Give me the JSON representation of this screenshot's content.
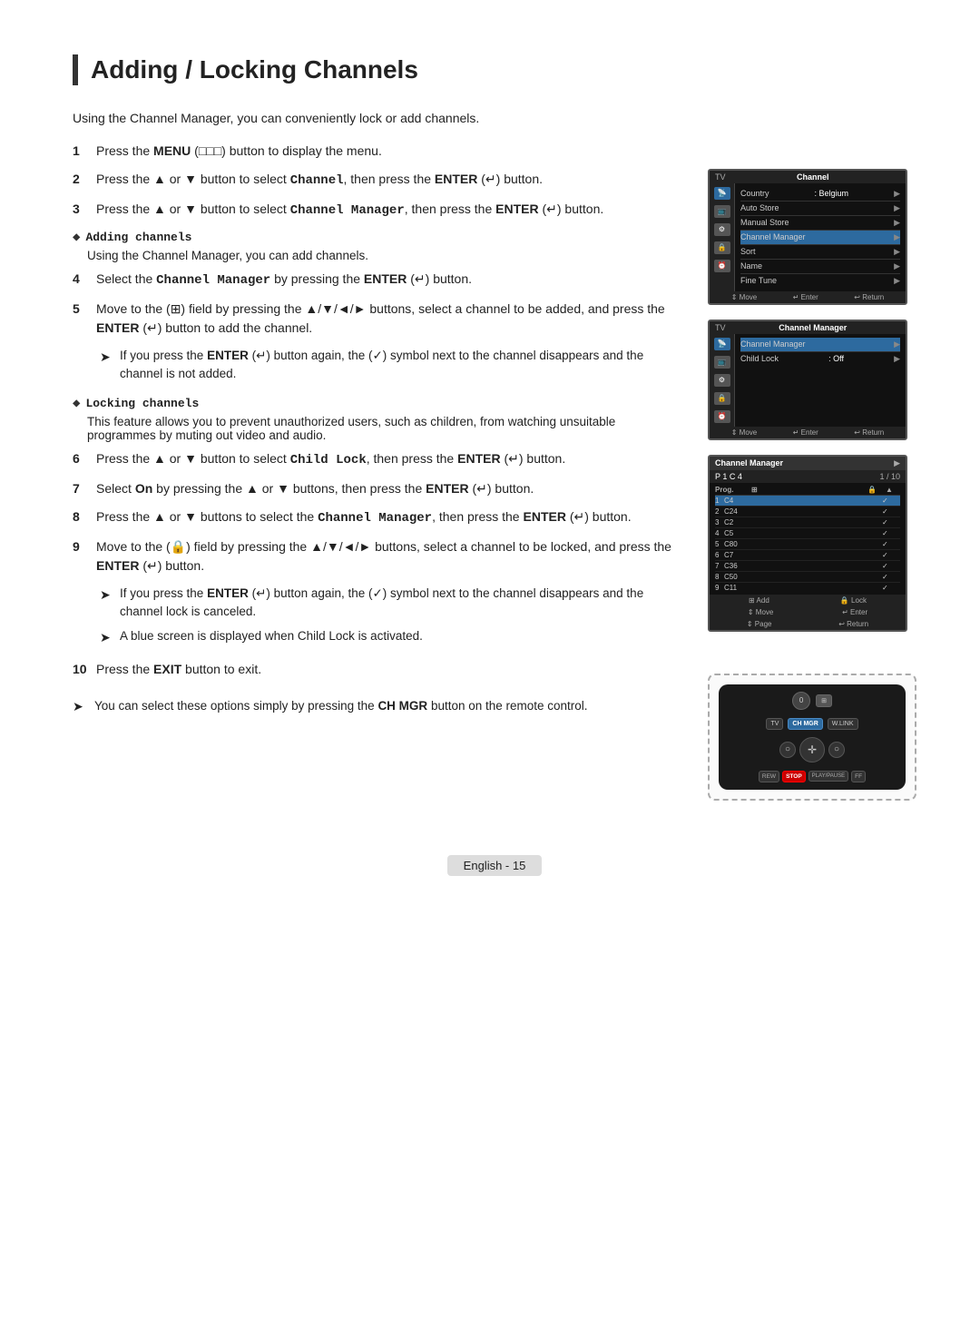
{
  "page": {
    "title": "Adding / Locking Channels",
    "intro": "Using the Channel Manager, you can conveniently lock or add channels.",
    "footer": "English - 15"
  },
  "steps": [
    {
      "num": "1",
      "text": "Press the MENU (□□□) button to display the menu."
    },
    {
      "num": "2",
      "text": "Press the ▲ or ▼ button to select Channel, then press the ENTER (↵) button."
    },
    {
      "num": "3",
      "text": "Press the ▲ or ▼ button to select Channel Manager, then press the ENTER (↵) button."
    }
  ],
  "adding_section": {
    "header": "Adding channels",
    "desc": "Using the Channel Manager, you can add channels.",
    "steps": [
      {
        "num": "4",
        "text": "Select the Channel Manager by pressing the ENTER (↵) button."
      },
      {
        "num": "5",
        "text": "Move to the (⊞) field by pressing the ▲/▼/◄/► buttons, select a channel to be added, and press the ENTER (↵) button to add the channel."
      }
    ],
    "arrow_notes": [
      "If you press the ENTER (↵) button again, the (✓) symbol next to the channel disappears and the channel is not added."
    ]
  },
  "locking_section": {
    "header": "Locking channels",
    "desc": "This feature allows you to prevent unauthorized users, such as children, from watching unsuitable programmes by muting out video and audio.",
    "steps": [
      {
        "num": "6",
        "text": "Press the ▲ or ▼ button to select Child Lock, then press the ENTER (↵) button."
      },
      {
        "num": "7",
        "text": "Select On by pressing the ▲ or ▼ buttons, then press the ENTER (↵) button."
      },
      {
        "num": "8",
        "text": "Press the ▲ or ▼ buttons to select the Channel Manager, then press the ENTER (↵) button."
      },
      {
        "num": "9",
        "text": "Move to the (🔒) field by pressing the ▲/▼/◄/► buttons, select a channel to be locked, and press the ENTER (↵) button."
      }
    ],
    "arrow_notes": [
      "If you press the ENTER (↵) button again, the (✓) symbol next to the channel disappears and the channel lock is canceled.",
      "A blue screen is displayed when Child Lock is activated."
    ]
  },
  "step10": {
    "num": "10",
    "text": "Press the EXIT button to exit."
  },
  "footer_note": "You can select these options simply by pressing the CH MGR button on the remote control.",
  "tv_screen1": {
    "title": "Channel",
    "items": [
      {
        "label": "Country",
        "value": ": Belgium"
      },
      {
        "label": "Auto Store",
        "value": ""
      },
      {
        "label": "Manual Store",
        "value": ""
      },
      {
        "label": "Channel Manager",
        "value": ""
      },
      {
        "label": "Sort",
        "value": ""
      },
      {
        "label": "Name",
        "value": ""
      },
      {
        "label": "Fine Tune",
        "value": ""
      }
    ],
    "footer": [
      "⇕ Move",
      "↵ Enter",
      "↩ Return"
    ]
  },
  "tv_screen2": {
    "title": "Channel Manager",
    "items": [
      {
        "label": "Channel Manager",
        "value": ""
      },
      {
        "label": "Child Lock",
        "value": ": Off"
      }
    ],
    "footer": [
      "⇕ Move",
      "↵ Enter",
      "↩ Return"
    ]
  },
  "tv_screen3": {
    "title": "Channel Manager",
    "subtitle": "P 1  C 4",
    "page": "1 / 10",
    "channels": [
      {
        "prog": "1",
        "ch": "C4",
        "check": "✓"
      },
      {
        "prog": "2",
        "ch": "C24",
        "check": "✓"
      },
      {
        "prog": "3",
        "ch": "C2",
        "check": "✓"
      },
      {
        "prog": "4",
        "ch": "C5",
        "check": "✓"
      },
      {
        "prog": "5",
        "ch": "C80",
        "check": "✓"
      },
      {
        "prog": "6",
        "ch": "C7",
        "check": "✓"
      },
      {
        "prog": "7",
        "ch": "C36",
        "check": "✓"
      },
      {
        "prog": "8",
        "ch": "C50",
        "check": "✓"
      },
      {
        "prog": "9",
        "ch": "C11",
        "check": "✓"
      }
    ],
    "footer1": [
      "⊞ Add",
      "🔒 Lock"
    ],
    "footer2": [
      "⇕ Move",
      "↵ Enter"
    ],
    "footer3": [
      "⇕ Page",
      "↩ Return"
    ]
  },
  "remote": {
    "label": "CH MGR button",
    "buttons": {
      "top_row": [
        "TV",
        "CH MGR",
        "W.LINK"
      ],
      "bottom_row": [
        "REW",
        "STOP",
        "PLAY/PAUSE",
        "FF"
      ]
    }
  }
}
